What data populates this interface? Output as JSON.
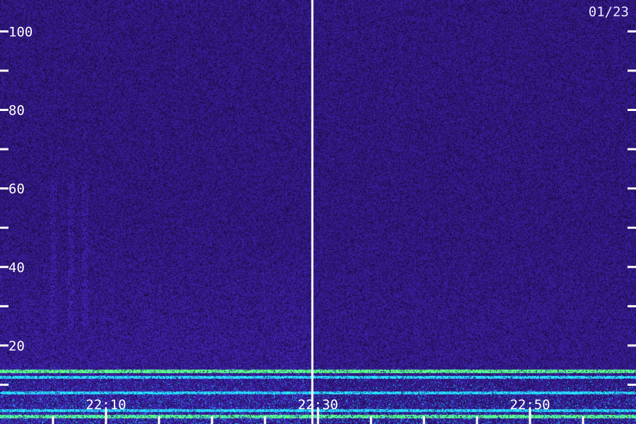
{
  "date_label": "01/23",
  "chart_data": {
    "type": "heatmap",
    "title": "",
    "xlabel": "",
    "ylabel": "",
    "y_ticks_labeled": [
      20,
      40,
      60,
      80,
      100
    ],
    "y_ticks_minor": [
      10,
      30,
      50,
      70,
      90
    ],
    "ylim": [
      0,
      108
    ],
    "x_tick_labels": [
      "22:10",
      "22:30",
      "22:50"
    ],
    "x_tick_minutes": [
      10,
      30,
      50
    ],
    "xlim_minutes": [
      0,
      60
    ],
    "x_minor_tick_minutes": [
      5,
      15,
      20,
      25,
      35,
      40,
      45,
      55
    ],
    "x_start_hour": 22,
    "divider_minute": 29,
    "colors": {
      "background": "#1a0a4a",
      "low": "#2a0a70",
      "mid": "#3a30d0",
      "high": "#20d0ff",
      "peak": "#60ff60",
      "axis": "#ffffff"
    },
    "bands": [
      {
        "freq": 16,
        "intensity": "high"
      },
      {
        "freq": 13.5,
        "intensity": "peak"
      },
      {
        "freq": 12,
        "intensity": "high"
      },
      {
        "freq": 8,
        "intensity": "high"
      },
      {
        "freq": 3.5,
        "intensity": "high"
      },
      {
        "freq": 2,
        "intensity": "peak"
      }
    ]
  }
}
